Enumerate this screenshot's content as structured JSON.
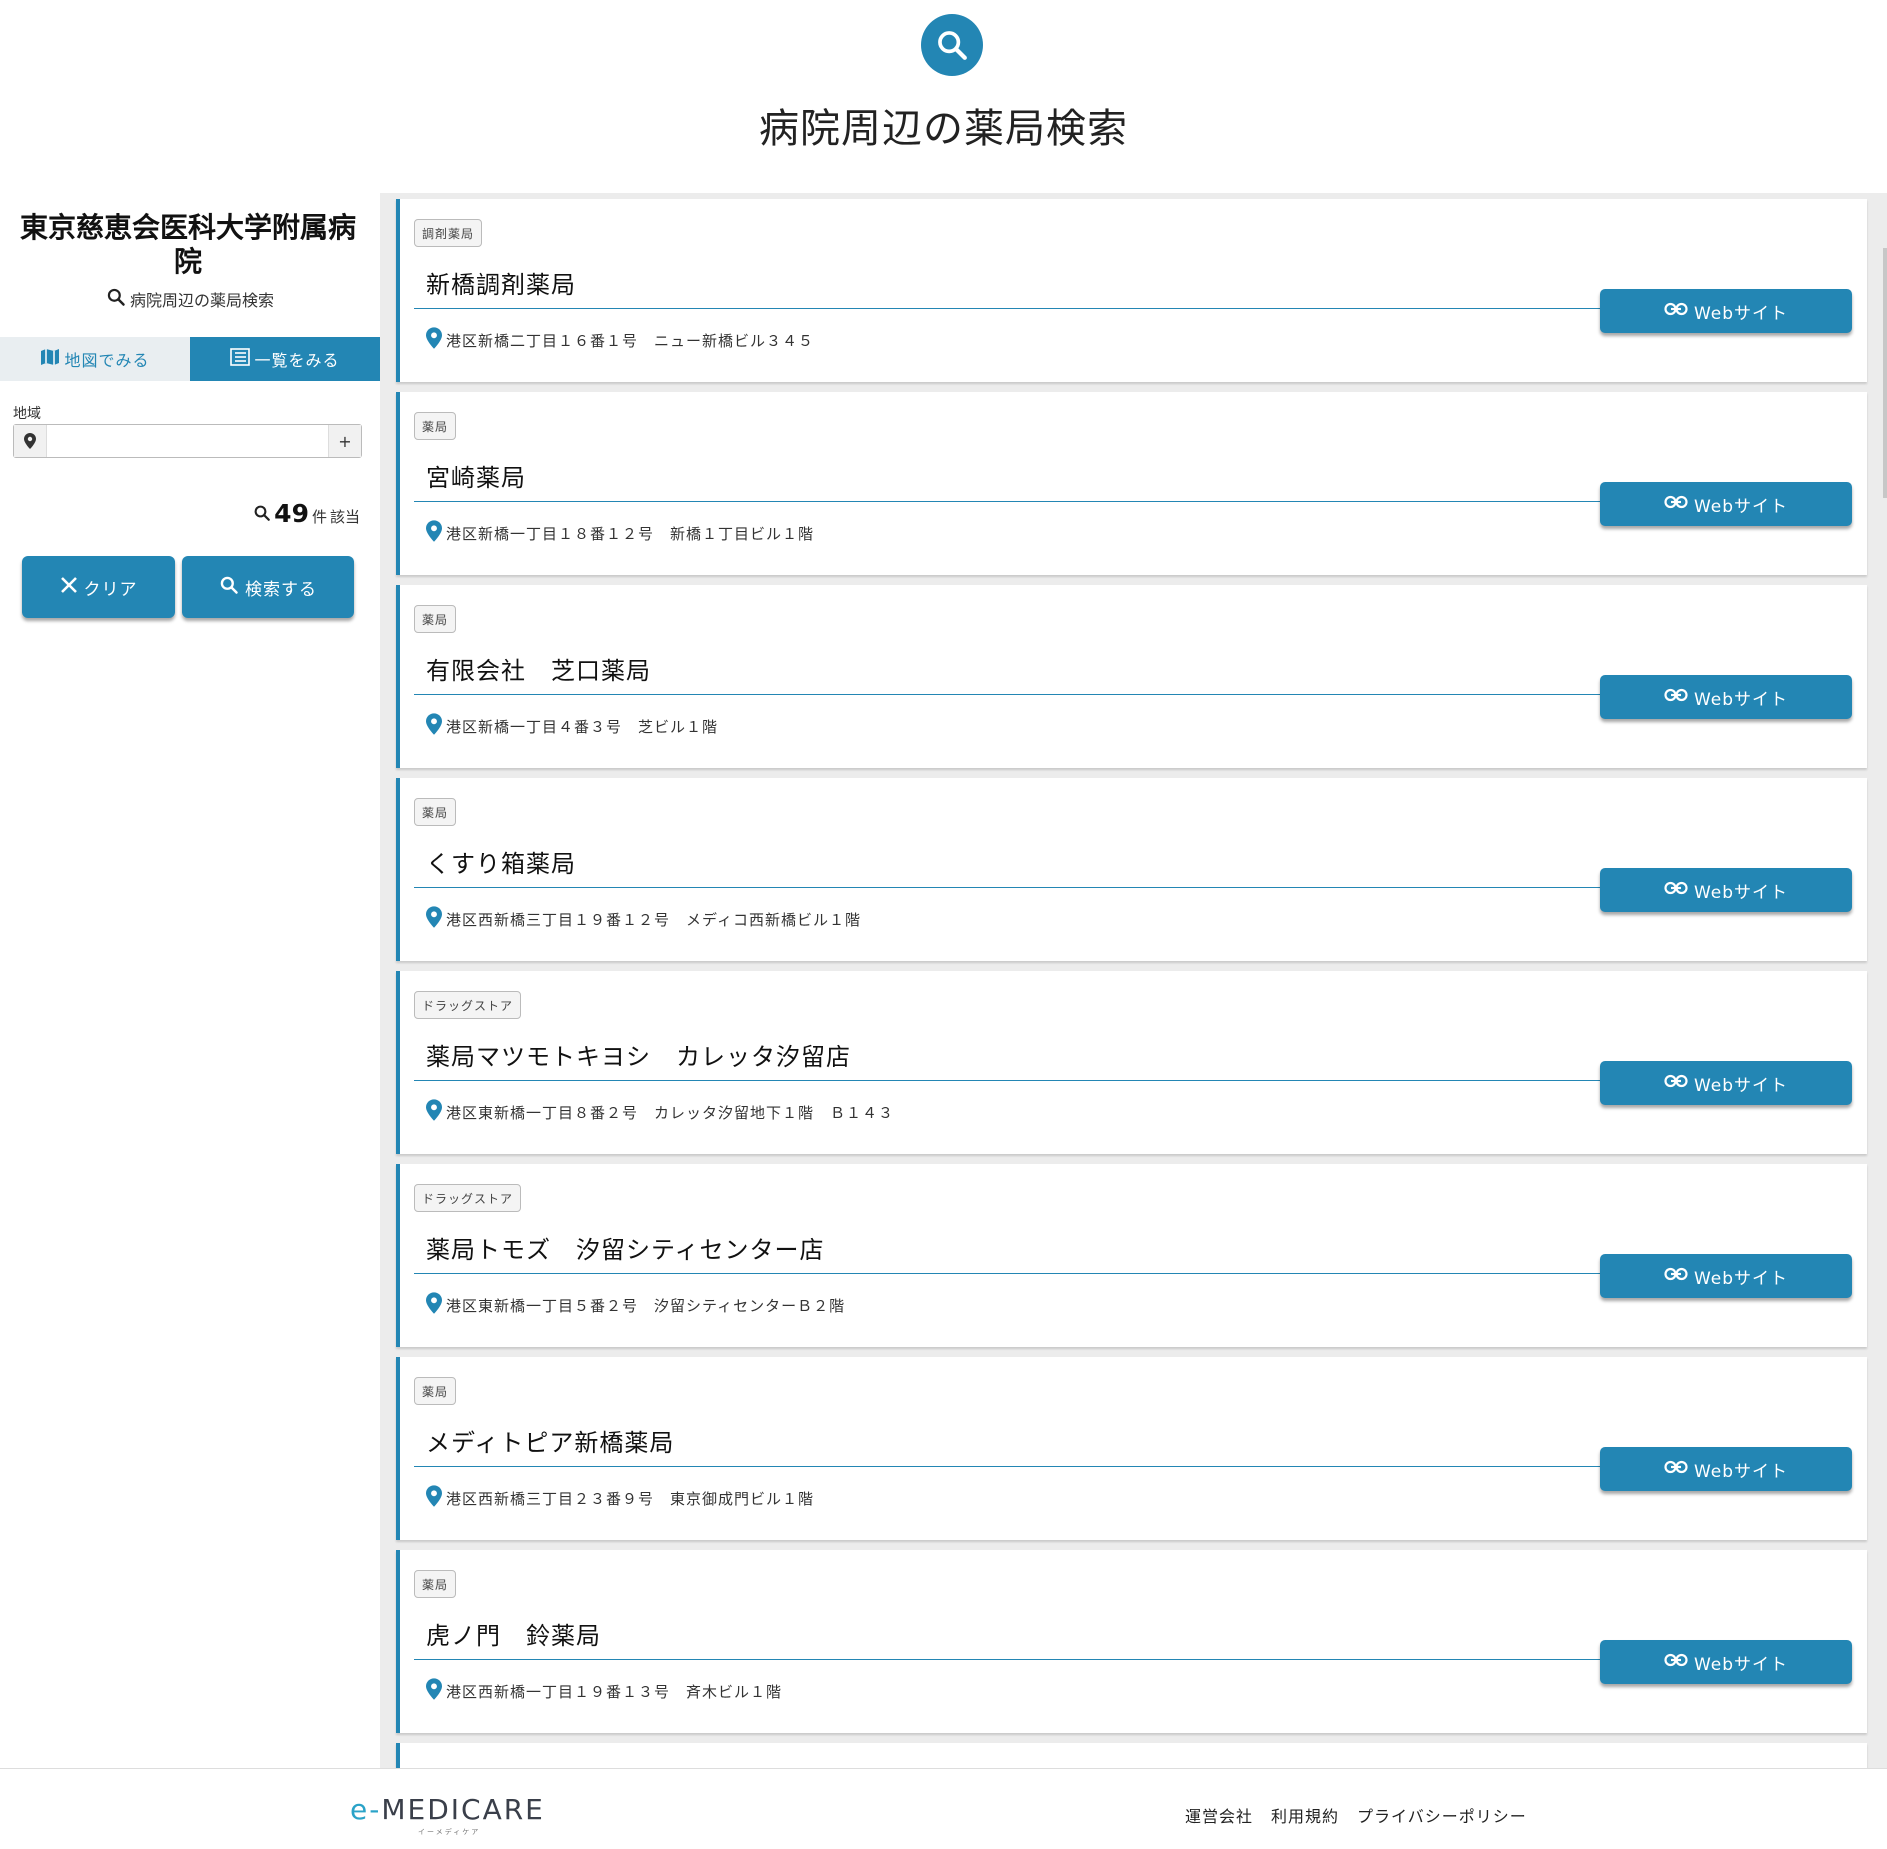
{
  "header": {
    "icon": "search-icon",
    "title": "病院周辺の薬局検索"
  },
  "sidebar": {
    "hospital_name": "東京慈恵会医科大学附属病院",
    "subtitle": "病院周辺の薬局検索",
    "tabs": [
      {
        "label": "地図でみる",
        "icon": "map-icon",
        "active": false
      },
      {
        "label": "一覧をみる",
        "icon": "list-icon",
        "active": true
      }
    ],
    "area": {
      "label": "地域",
      "value": "",
      "plus": "+"
    },
    "count": {
      "number": "49",
      "unit": "件",
      "suffix": "該当"
    },
    "clear_label": "クリア",
    "search_label": "検索する"
  },
  "results": [
    {
      "category": "調剤薬局",
      "name": "新橋調剤薬局",
      "address": "港区新橋二丁目１６番１号　ニュー新橋ビル３４５",
      "web_label": "Webサイト"
    },
    {
      "category": "薬局",
      "name": "宮崎薬局",
      "address": "港区新橋一丁目１８番１２号　新橋１丁目ビル１階",
      "web_label": "Webサイト"
    },
    {
      "category": "薬局",
      "name": "有限会社　芝口薬局",
      "address": "港区新橋一丁目４番３号　芝ビル１階",
      "web_label": "Webサイト"
    },
    {
      "category": "薬局",
      "name": "くすり箱薬局",
      "address": "港区西新橋三丁目１９番１２号　メディコ西新橋ビル１階",
      "web_label": "Webサイト"
    },
    {
      "category": "ドラッグストア",
      "name": "薬局マツモトキヨシ　カレッタ汐留店",
      "address": "港区東新橋一丁目８番２号　カレッタ汐留地下１階　Ｂ１４３",
      "web_label": "Webサイト"
    },
    {
      "category": "ドラッグストア",
      "name": "薬局トモズ　汐留シティセンター店",
      "address": "港区東新橋一丁目５番２号　汐留シティセンターＢ２階",
      "web_label": "Webサイト"
    },
    {
      "category": "薬局",
      "name": "メディトピア新橋薬局",
      "address": "港区西新橋三丁目２３番９号　東京御成門ビル１階",
      "web_label": "Webサイト"
    },
    {
      "category": "薬局",
      "name": "虎ノ門　鈴薬局",
      "address": "港区西新橋一丁目１９番１３号　斉木ビル１階",
      "web_label": "Webサイト"
    }
  ],
  "footer": {
    "logo_prefix": "e-",
    "logo_main": "MEDICARE",
    "logo_sub": "イーメディケア",
    "links": [
      "運営会社",
      "利用規約",
      "プライバシーポリシー"
    ]
  },
  "colors": {
    "accent": "#2386b4",
    "list_bg": "#ececec"
  }
}
